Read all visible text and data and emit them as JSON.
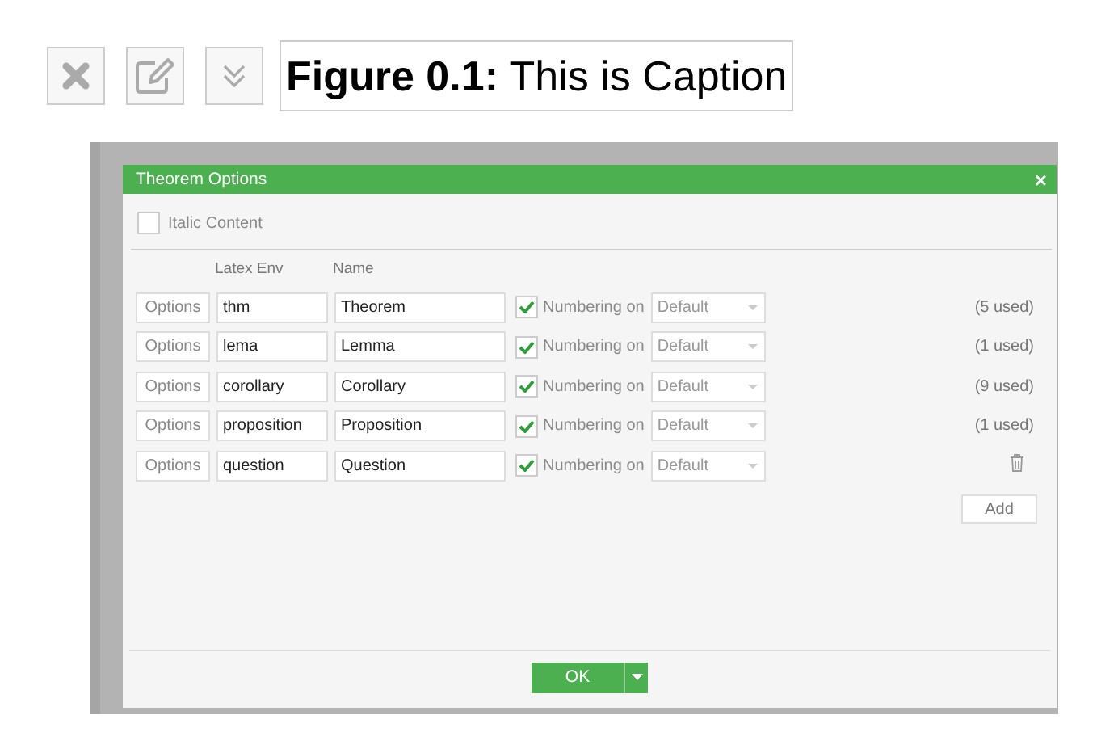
{
  "caption": {
    "text": "**Figure 0.1:** This is Caption"
  },
  "dialog": {
    "title": "Theorem Options",
    "close": "×",
    "italic_content": {
      "label": "Italic Content",
      "checked": false
    },
    "columns": [
      "Latex Env",
      "Name"
    ],
    "rows": [
      {
        "options": "Options",
        "env": "thm",
        "name": "Theorem",
        "numbering": true,
        "numbering_label": "Numbering on",
        "numbering_select": "Default",
        "used": "(5 used)"
      },
      {
        "options": "Options",
        "env": "lema",
        "name": "Lemma",
        "numbering": true,
        "numbering_label": "Numbering on",
        "numbering_select": "Default",
        "used": "(1 used)"
      },
      {
        "options": "Options",
        "env": "corollary",
        "name": "Corollary",
        "numbering": true,
        "numbering_label": "Numbering on",
        "numbering_select": "Default",
        "used": "(9 used)"
      },
      {
        "options": "Options",
        "env": "proposition",
        "name": "Proposition",
        "numbering": true,
        "numbering_label": "Numbering on",
        "numbering_select": "Default",
        "used": "(1 used)"
      },
      {
        "options": "Options",
        "env": "question",
        "name": "Question",
        "numbering": true,
        "numbering_label": "Numbering on",
        "numbering_select": "Default"
      }
    ],
    "add_button": "Add",
    "ok_button": "OK"
  }
}
